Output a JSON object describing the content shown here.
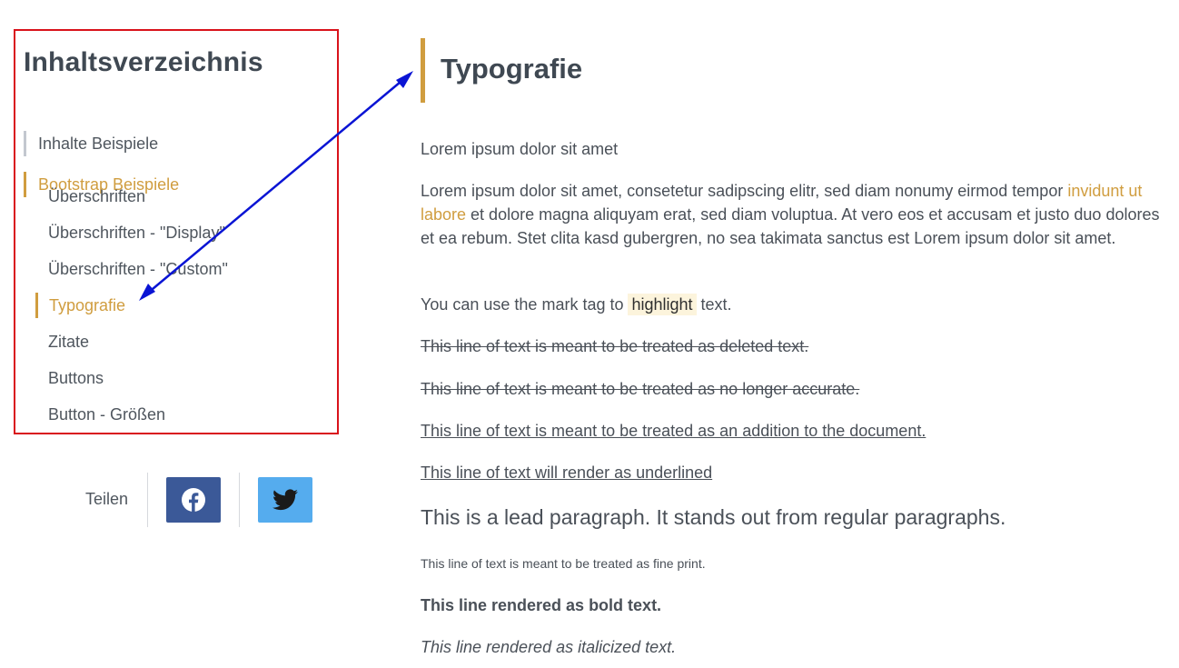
{
  "toc": {
    "title": "Inhaltsverzeichnis",
    "items": [
      {
        "label": "Inhalte Beispiele"
      },
      {
        "label": "Bootstrap Beispiele"
      },
      {
        "label": "Überschriften"
      },
      {
        "label": "Überschriften - \"Display\""
      },
      {
        "label": "Überschriften - \"Custom\""
      },
      {
        "label": "Typografie"
      },
      {
        "label": "Zitate"
      },
      {
        "label": "Buttons"
      },
      {
        "label": "Button - Größen"
      }
    ]
  },
  "share": {
    "label": "Teilen",
    "buttons": [
      {
        "icon": "facebook-icon"
      },
      {
        "icon": "twitter-icon"
      }
    ]
  },
  "content": {
    "title": "Typografie",
    "p1": "Lorem ipsum dolor sit amet",
    "p2_start": "Lorem ipsum dolor sit amet, consetetur sadipscing elitr, sed diam nonumy eirmod tempor ",
    "p2_link": "invidunt ut labore",
    "p2_end": " et dolore magna aliquyam erat, sed diam voluptua. At vero eos et accusam et justo duo dolores et ea rebum. Stet clita kasd gubergren, no sea takimata sanctus est Lorem ipsum dolor sit amet.",
    "mark_before": "You can use the mark tag to ",
    "mark_text": "highlight",
    "mark_after": " text.",
    "deleted": "This line of text is meant to be treated as deleted text.",
    "strike": "This line of text is meant to be treated as no longer accurate.",
    "inserted": "This line of text is meant to be treated as an addition to the document.",
    "underlined": "This line of text will render as underlined",
    "lead": "This is a lead paragraph. It stands out from regular paragraphs.",
    "fine_print": "This line of text is meant to be treated as fine print.",
    "bold": "This line rendered as bold text.",
    "italic": "This line rendered as italicized text."
  },
  "colors": {
    "accent": "#d09d3f",
    "annotation_box": "#d9121b",
    "annotation_arrow": "#0a14d4",
    "facebook": "#3b5998",
    "twitter": "#55acee"
  }
}
